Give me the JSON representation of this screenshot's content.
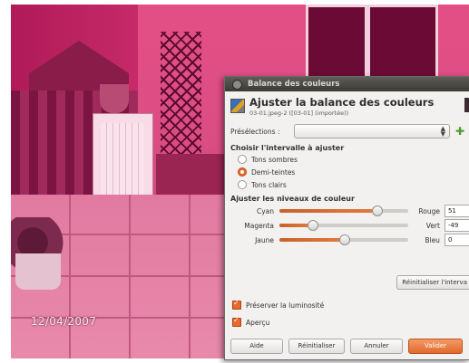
{
  "photo": {
    "date_stamp": "12/04/2007"
  },
  "dialog": {
    "window_title": "Balance des couleurs",
    "header_title": "Ajuster la balance des couleurs",
    "header_subtitle": "03-01.jpeg-2 ([03-01] (importée))",
    "presets_label": "Présélections :",
    "presets_value": "",
    "range_section": "Choisir l'intervalle à ajuster",
    "ranges": [
      {
        "label": "Tons sombres",
        "selected": false
      },
      {
        "label": "Demi-teintes",
        "selected": true
      },
      {
        "label": "Tons clairs",
        "selected": false
      }
    ],
    "levels_section": "Ajuster les niveaux de couleur",
    "sliders": [
      {
        "left": "Cyan",
        "right": "Rouge",
        "value": "51",
        "level": 51
      },
      {
        "left": "Magenta",
        "right": "Vert",
        "value": "-49",
        "level": -49
      },
      {
        "left": "Jaune",
        "right": "Bleu",
        "value": "0",
        "level": 0
      }
    ],
    "reset_range_label": "Réinitialiser l'interva",
    "preserve_luminosity": {
      "label": "Préserver la luminosité",
      "checked": true
    },
    "preview": {
      "label": "Aperçu",
      "checked": true
    },
    "buttons": {
      "help": "Aide",
      "reset": "Réinitialiser",
      "cancel": "Annuler",
      "ok": "Valider"
    }
  },
  "colors": {
    "accent": "#e86a2c"
  }
}
